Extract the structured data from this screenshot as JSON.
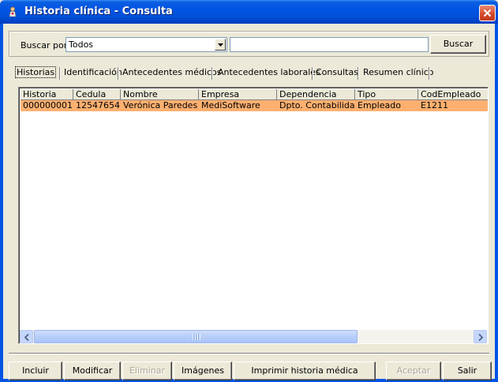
{
  "window": {
    "title": "Historia clínica - Consulta"
  },
  "search": {
    "label": "Buscar por",
    "field_value": "Todos",
    "query_value": "",
    "button_label": "Buscar"
  },
  "tabs": [
    {
      "label": "Historias",
      "active": true
    },
    {
      "label": "Identificación"
    },
    {
      "label": "Antecedentes médicos"
    },
    {
      "label": "Antecedentes laborales"
    },
    {
      "label": "Consultas"
    },
    {
      "label": "Resumen clínico"
    }
  ],
  "grid": {
    "columns": [
      "Historia",
      "Cedula",
      "Nombre",
      "Empresa",
      "Dependencia",
      "Tipo",
      "CodEmpleado"
    ],
    "rows": [
      [
        "000000001",
        "12547654",
        "Verónica Paredes",
        "MediSoftware",
        "Dpto. Contabilidad",
        "Empleado",
        "E1211"
      ]
    ],
    "selected_row_color": "#ffb070"
  },
  "buttons": {
    "incluir": "Incluir",
    "modificar": "Modificar",
    "eliminar": "Eliminar",
    "imagenes": "Imágenes",
    "imprimir": "Imprimir historia médica completa",
    "aceptar": "Aceptar",
    "salir": "Salir"
  },
  "icons": {
    "title": "app-icon",
    "close": "close-icon",
    "combo": "chevron-down-icon",
    "scroll_left": "arrow-left-icon",
    "scroll_right": "arrow-right-icon"
  }
}
